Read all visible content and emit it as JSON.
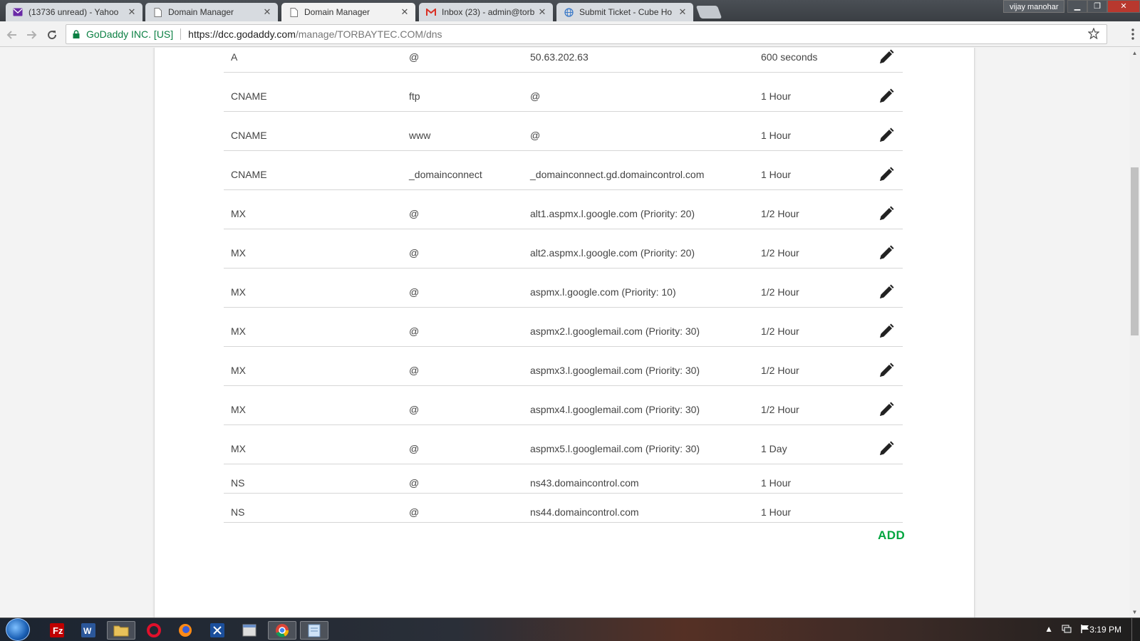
{
  "browser": {
    "tabs": [
      {
        "label": "(13736 unread) - Yahoo",
        "icon": "yahoo-mail-icon"
      },
      {
        "label": "Domain Manager",
        "icon": "page-icon"
      },
      {
        "label": "Domain Manager",
        "icon": "page-icon",
        "active": true
      },
      {
        "label": "Inbox (23) - admin@torb",
        "icon": "gmail-icon"
      },
      {
        "label": "Submit Ticket - Cube Ho",
        "icon": "globe-icon"
      }
    ],
    "close_glyph": "✕",
    "profile_name": "vijay manohar",
    "window_buttons": {
      "minimize": "▁",
      "restore": "❐",
      "close": "✕"
    },
    "security_label": "GoDaddy INC. [US]",
    "url_host": "https://dcc.godaddy.com",
    "url_path": "/manage/TORBAYTEC.COM/dns"
  },
  "dns_records": [
    {
      "type": "A",
      "name": "@",
      "value": "50.63.202.63",
      "ttl": "600 seconds",
      "editable": true
    },
    {
      "type": "CNAME",
      "name": "ftp",
      "value": "@",
      "ttl": "1 Hour",
      "editable": true
    },
    {
      "type": "CNAME",
      "name": "www",
      "value": "@",
      "ttl": "1 Hour",
      "editable": true
    },
    {
      "type": "CNAME",
      "name": "_domainconnect",
      "value": "_domainconnect.gd.domaincontrol.com",
      "ttl": "1 Hour",
      "editable": true
    },
    {
      "type": "MX",
      "name": "@",
      "value": "alt1.aspmx.l.google.com (Priority: 20)",
      "ttl": "1/2 Hour",
      "editable": true
    },
    {
      "type": "MX",
      "name": "@",
      "value": "alt2.aspmx.l.google.com (Priority: 20)",
      "ttl": "1/2 Hour",
      "editable": true
    },
    {
      "type": "MX",
      "name": "@",
      "value": "aspmx.l.google.com (Priority: 10)",
      "ttl": "1/2 Hour",
      "editable": true
    },
    {
      "type": "MX",
      "name": "@",
      "value": "aspmx2.l.googlemail.com (Priority: 30)",
      "ttl": "1/2 Hour",
      "editable": true
    },
    {
      "type": "MX",
      "name": "@",
      "value": "aspmx3.l.googlemail.com (Priority: 30)",
      "ttl": "1/2 Hour",
      "editable": true
    },
    {
      "type": "MX",
      "name": "@",
      "value": "aspmx4.l.googlemail.com (Priority: 30)",
      "ttl": "1/2 Hour",
      "editable": true
    },
    {
      "type": "MX",
      "name": "@",
      "value": "aspmx5.l.googlemail.com (Priority: 30)",
      "ttl": "1 Day",
      "editable": true
    },
    {
      "type": "NS",
      "name": "@",
      "value": "ns43.domaincontrol.com",
      "ttl": "1 Hour",
      "editable": false
    },
    {
      "type": "NS",
      "name": "@",
      "value": "ns44.domaincontrol.com",
      "ttl": "1 Hour",
      "editable": false
    }
  ],
  "add_label": "ADD",
  "colors": {
    "add_green": "#00a63f",
    "ev_green": "#0b8043"
  },
  "taskbar": {
    "apps": [
      "filezilla-icon",
      "word-icon",
      "explorer-icon",
      "opera-icon",
      "firefox-icon",
      "app-icon",
      "window-icon",
      "chrome-icon",
      "notepad-icon"
    ],
    "clock": "3:19 PM"
  }
}
